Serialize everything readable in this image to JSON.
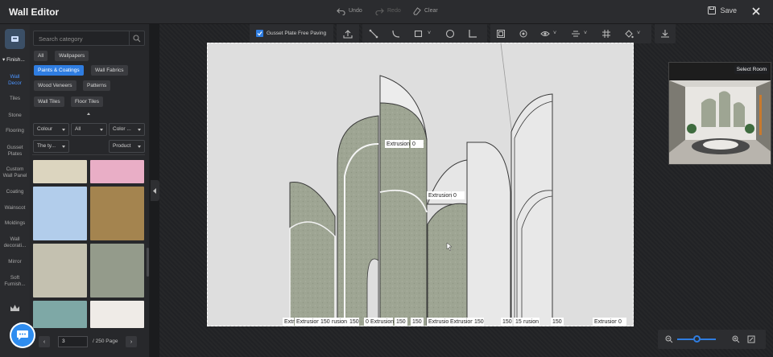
{
  "app": {
    "title": "Wall Editor"
  },
  "header": {
    "undo": "Undo",
    "redo": "Redo",
    "clear": "Clear",
    "save": "Save"
  },
  "rail": {
    "section": "Finish...",
    "items": [
      "Wall\nDecor",
      "Tiles",
      "Stone",
      "Flooring",
      "Gusset\nPlates",
      "Custom\nWall Panel",
      "Coating",
      "Wainscot",
      "Moldings",
      "Wall\ndecorati...",
      "Mirror",
      "Soft\nFurnish..."
    ]
  },
  "panel": {
    "search_placeholder": "Search category",
    "chips": [
      "All",
      "Wallpapers",
      "Paints & Coatings",
      "Wall Fabrics",
      "Wood Veneers",
      "Patterns",
      "Wall Tiles",
      "Floor Tiles"
    ],
    "active_chip": "Paints & Coatings",
    "filters": [
      "Colour",
      "All",
      "Color ...",
      "The ty...",
      "Product"
    ],
    "swatch_colors": [
      "#dcd5bf",
      "#e9aec6",
      "#b2cdeb",
      "#a4844f",
      "#c4c1b0",
      "#949b8b",
      "#7ea8a6",
      "#efebe7"
    ],
    "pager": {
      "current": "3",
      "total": "/ 250 Page"
    }
  },
  "toolbar": {
    "gusset_label": "Gusset Plate Free Paving",
    "gusset_checked": true
  },
  "canvas": {
    "extrusion_labels": [
      "Extrusion",
      "0",
      "Extrusion",
      "0"
    ],
    "bottom_labels": [
      "Extn",
      "Extrusion",
      "150",
      "rusion",
      "150",
      "0",
      "Extrusion",
      "150",
      "150",
      "Extrusior",
      "Extrusion",
      "150",
      "150",
      "150",
      "rusion",
      "150",
      "Extrusion",
      "0"
    ]
  },
  "preview": {
    "select_room": "Select Room"
  },
  "colors": {
    "accent": "#2f7de1",
    "panel_fill": "#9ea593"
  }
}
